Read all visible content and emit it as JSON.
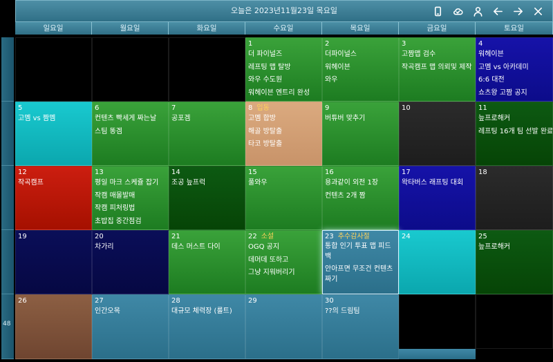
{
  "titlebar": {
    "title": "오늘은 2023년11월23일 목요일",
    "icons": [
      "phone-icon",
      "cloud-check-icon",
      "user-icon",
      "arrow-left-icon",
      "arrow-right-icon",
      "close-icon"
    ]
  },
  "weekdays": [
    "일요일",
    "월요일",
    "화요일",
    "수요일",
    "목요일",
    "금요일",
    "토요일"
  ],
  "week_label": "48",
  "colors": {
    "green": "#2e9430",
    "dark_green": "#0a4f0e",
    "blue": "#3680a0",
    "cyan": "#14bcc2",
    "red": "#bb1708",
    "violet": "#1410a0",
    "navy": "#080b4f",
    "gray": "#262626",
    "peach": "#d3a077",
    "brown": "#7e5239",
    "holiday_text": "#ffd25a"
  },
  "weeks": [
    [
      {
        "day": "",
        "color": "blk",
        "events": []
      },
      {
        "day": "",
        "color": "blk",
        "events": []
      },
      {
        "day": "",
        "color": "blk",
        "events": []
      },
      {
        "day": "1",
        "color": "g",
        "events": [
          "더 파이널즈",
          "레프팅 맵 탈방",
          "와우 수도원",
          "워헤이븐 엔트리 완성"
        ]
      },
      {
        "day": "2",
        "color": "g",
        "events": [
          "더파이널스",
          "워헤이븐",
          "와우"
        ]
      },
      {
        "day": "3",
        "color": "g",
        "events": [
          "고짬맵 검수",
          "작곡캠프 맵 의뢰및 제작"
        ]
      },
      {
        "day": "4",
        "color": "vi",
        "events": [
          "워헤이븐",
          "고멤 vs 아카데미",
          "6:6 대전",
          "쇼츠왕 고짬 공지"
        ]
      }
    ],
    [
      {
        "day": "5",
        "color": "cy",
        "events": [
          "고멤 vs 짬멤"
        ]
      },
      {
        "day": "6",
        "color": "g",
        "events": [
          "컨텐츠 빡세게 짜는날",
          "스팀 똥겜"
        ]
      },
      {
        "day": "7",
        "color": "g",
        "events": [
          "공포겜"
        ]
      },
      {
        "day": "8",
        "holiday": "입동",
        "color": "pe",
        "events": [
          "고멤 합방",
          "해골 방탈출",
          "타코 방탈출"
        ]
      },
      {
        "day": "9",
        "color": "g",
        "events": [
          "버튜버 맞추기"
        ]
      },
      {
        "day": "10",
        "color": "gr",
        "events": []
      },
      {
        "day": "11",
        "color": "gd",
        "events": [
          "늪프로해커",
          "레프팅 16개 팀 선발 완료"
        ]
      }
    ],
    [
      {
        "day": "12",
        "color": "rd",
        "events": [
          "작곡캠프"
        ]
      },
      {
        "day": "13",
        "color": "g",
        "events": [
          "평일 마크 스케쥴 잡기",
          "작캠 매몰발매",
          "작캠 피처링법",
          "초밥집 중간점검"
        ]
      },
      {
        "day": "14",
        "color": "gd",
        "events": [
          "조공 늪프럭"
        ]
      },
      {
        "day": "15",
        "color": "g",
        "events": [
          "풀와우"
        ]
      },
      {
        "day": "16",
        "color": "g",
        "events": [
          "용과같이 외전 1장",
          "컨텐츠 2개 짬"
        ]
      },
      {
        "day": "17",
        "color": "vi",
        "events": [
          "왁타버스 래프팅 대회"
        ]
      },
      {
        "day": "18",
        "color": "gr",
        "events": []
      }
    ],
    [
      {
        "day": "19",
        "color": "nv",
        "events": []
      },
      {
        "day": "20",
        "color": "nv",
        "events": [
          "차가리"
        ]
      },
      {
        "day": "21",
        "color": "g",
        "events": [
          "데스 머스트 다이"
        ]
      },
      {
        "day": "22",
        "holiday": "소설",
        "color": "g",
        "events": [
          "OGQ 공지",
          "데머데 또하고",
          "그냥 지워버리기"
        ]
      },
      {
        "day": "23",
        "holiday": "추수감사절",
        "color": "sel",
        "events": [
          "통합 인기 투표 맵 피드백",
          "안아프면 무조건 컨텐츠 짜기"
        ]
      },
      {
        "day": "24",
        "color": "cy",
        "events": []
      },
      {
        "day": "25",
        "color": "gd",
        "events": [
          "늪프로해커"
        ]
      }
    ],
    [
      {
        "day": "26",
        "color": "br",
        "events": []
      },
      {
        "day": "27",
        "color": "bl",
        "events": [
          "인간오목"
        ]
      },
      {
        "day": "28",
        "color": "bl",
        "events": [
          "대규모 체력장 (룰트)"
        ]
      },
      {
        "day": "29",
        "color": "bl",
        "events": []
      },
      {
        "day": "30",
        "color": "bl",
        "events": [
          "??의 드림팀"
        ]
      },
      {
        "day": "",
        "color": "blk",
        "events": []
      },
      {
        "day": "",
        "color": "blk",
        "events": []
      }
    ]
  ]
}
